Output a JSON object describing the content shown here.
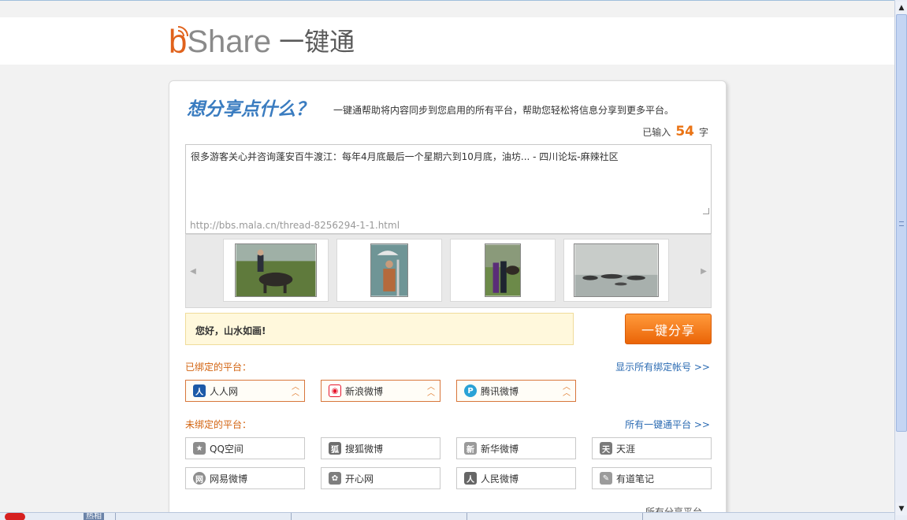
{
  "header": {
    "logo_share": "Share",
    "logo_cn": "一键通"
  },
  "card": {
    "title": "想分享点什么？",
    "description": "一键通帮助将内容同步到您启用的所有平台，帮助您轻松将信息分享到更多平台。",
    "count_prefix": "已输入",
    "count_value": "54",
    "count_suffix": "字",
    "share_text": "很多游客关心并咨询蓬安百牛渡江：每年4月底最后一个星期六到10月底，油坊... - 四川论坛-麻辣社区",
    "share_url": "http://bbs.mala.cn/thread-8256294-1-1.html",
    "greeting": "您好，山水如画!",
    "share_button": "一键分享"
  },
  "bound": {
    "label": "已绑定的平台：",
    "link": "显示所有绑定帐号 >>",
    "platforms": [
      {
        "name": "人人网",
        "icon": "renren-icon",
        "color": "#1d5aa8"
      },
      {
        "name": "新浪微博",
        "icon": "weibo-icon",
        "color": "#e6162d"
      },
      {
        "name": "腾讯微博",
        "icon": "tencent-weibo-icon",
        "color": "#2aa2d6"
      }
    ]
  },
  "unbound": {
    "label": "未绑定的平台：",
    "link": "所有一键通平台 >>",
    "platforms": [
      {
        "name": "QQ空间",
        "icon": "qzone-icon"
      },
      {
        "name": "搜狐微博",
        "icon": "sohu-weibo-icon"
      },
      {
        "name": "新华微博",
        "icon": "xinhua-weibo-icon"
      },
      {
        "name": "天涯",
        "icon": "tianya-icon"
      },
      {
        "name": "网易微博",
        "icon": "netease-weibo-icon"
      },
      {
        "name": "开心网",
        "icon": "kaixin-icon"
      },
      {
        "name": "人民微博",
        "icon": "people-weibo-icon"
      },
      {
        "name": "有道笔记",
        "icon": "youdao-note-icon"
      }
    ]
  },
  "footer": {
    "partial_text": "所有分享平台"
  },
  "taskbar": {
    "item": "热相"
  }
}
